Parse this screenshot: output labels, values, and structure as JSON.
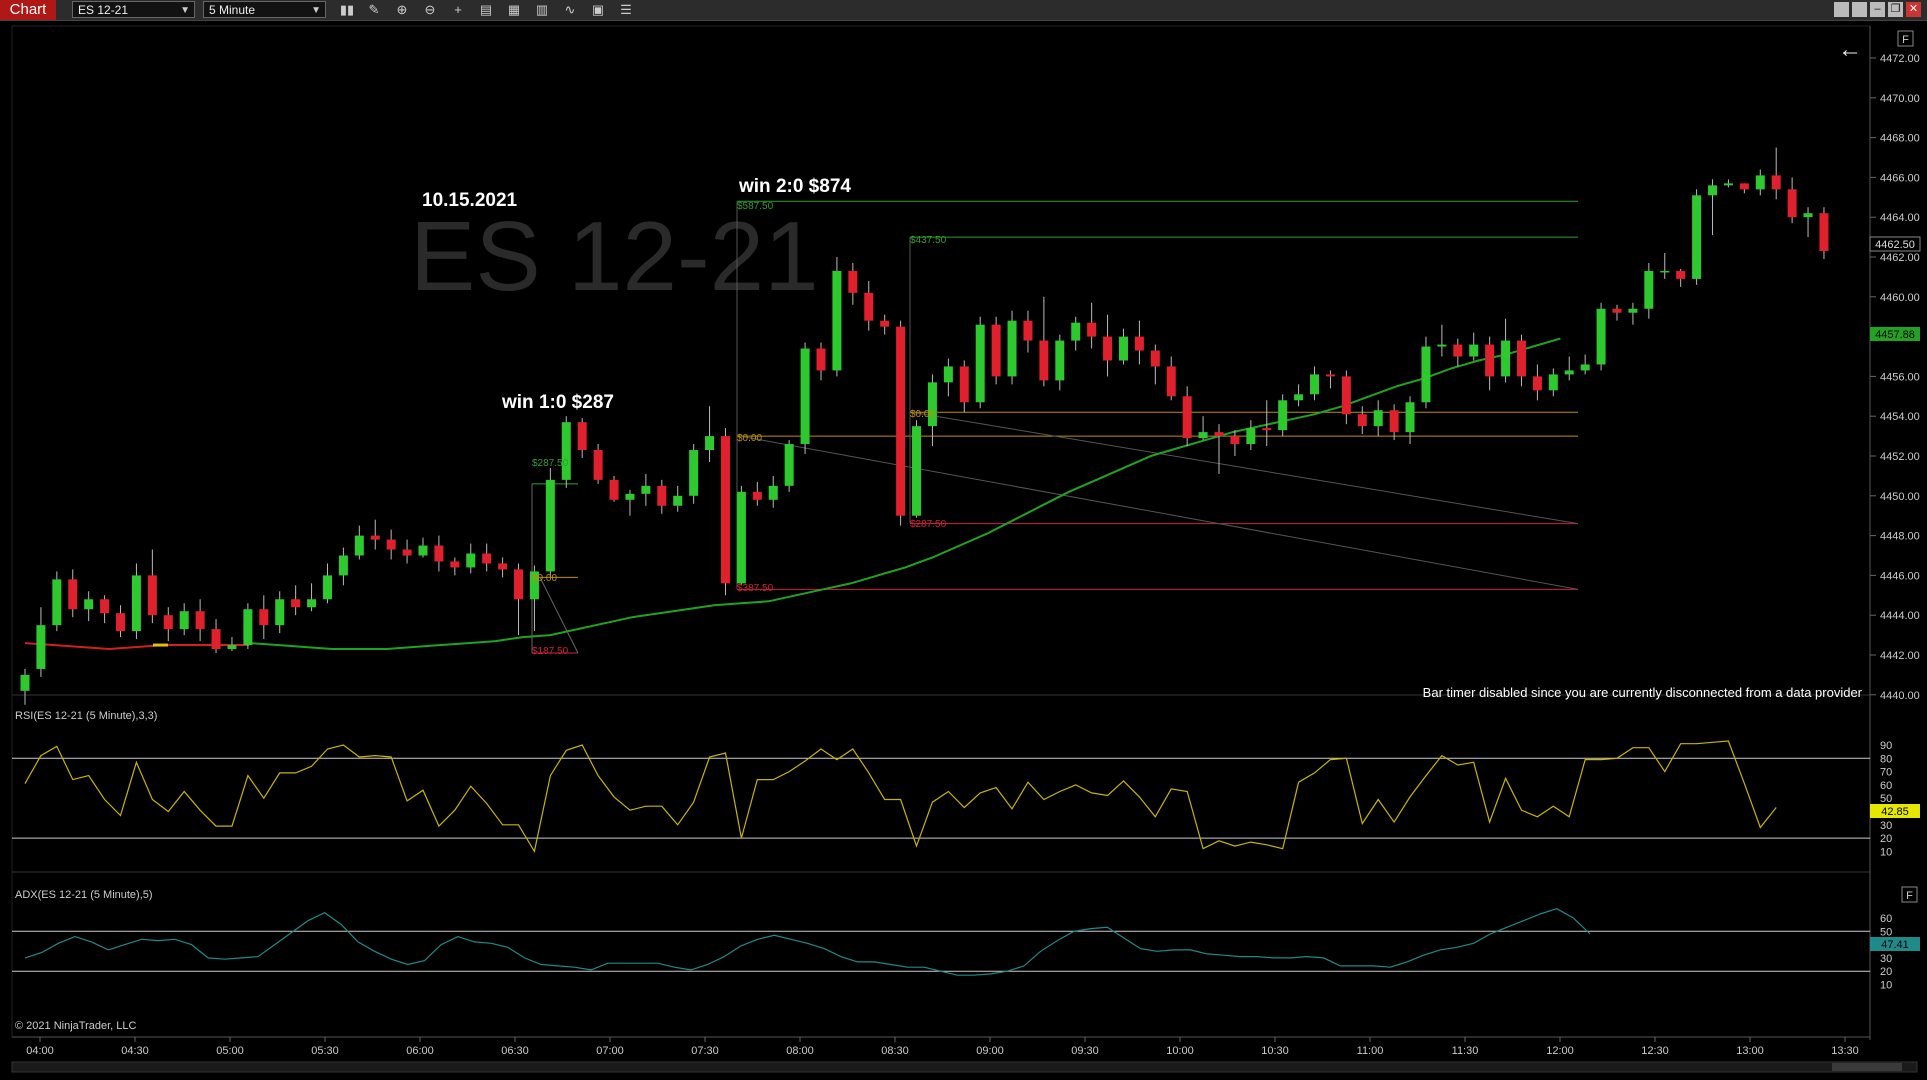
{
  "toolbar": {
    "tab_label": "Chart",
    "instrument": "ES 12-21",
    "interval": "5 Minute",
    "tools": [
      "bar-type-icon",
      "draw-pencil-icon",
      "zoom-in-icon",
      "zoom-out-icon",
      "crosshair-icon",
      "properties-icon",
      "data-box-icon",
      "indicators-icon",
      "strategies-icon",
      "templates-icon",
      "list-icon"
    ]
  },
  "chart": {
    "watermark": "ES 12-21",
    "date_label": "10.15.2021",
    "win1_label": "win 1:0 $287",
    "win2_label": "win 2:0 $874",
    "bar_timer_msg": "Bar timer disabled since you are currently disconnected from a data provider",
    "copyright": "© 2021 NinjaTrader, LLC",
    "f_button": "F",
    "current_price_label": "4462.50",
    "ma_value_label": "4457.88",
    "price_ticks": [
      "4472.00",
      "4470.00",
      "4468.00",
      "4466.00",
      "4464.00",
      "4462.00",
      "4460.00",
      "4458.00",
      "4456.00",
      "4454.00",
      "4452.00",
      "4450.00",
      "4448.00",
      "4446.00",
      "4444.00",
      "4442.00",
      "4440.00"
    ],
    "time_ticks": [
      "04:00",
      "04:30",
      "05:00",
      "05:30",
      "06:00",
      "06:30",
      "07:00",
      "07:30",
      "08:00",
      "08:30",
      "09:00",
      "09:30",
      "10:00",
      "10:30",
      "11:00",
      "11:30",
      "12:00",
      "12:30",
      "13:00",
      "13:30"
    ],
    "trade_labels": {
      "t1_profit": "$287.50",
      "t1_entry": "$0.00",
      "t1_stop": "$187.50",
      "t2_target1": "$587.50",
      "t2_target2": "$437.50",
      "t2_entry1": "$0.00",
      "t2_entry2": "$0.00",
      "t2_stop1": "$287.50",
      "t2_stop2": "$387.50"
    },
    "colors": {
      "up": "#2ec92e",
      "down": "#e0202c",
      "ma": "#21a321",
      "rsi": "#c8b400",
      "adx": "#1f8a8a",
      "target": "#2f9e2f",
      "entry": "#c09000",
      "stop": "#d0203a"
    }
  },
  "rsi": {
    "title": "RSI(ES 12-21 (5 Minute),3,3)",
    "value_label": "42.85",
    "ticks": [
      "90",
      "80",
      "70",
      "60",
      "50",
      "40",
      "30",
      "20",
      "10"
    ],
    "values": [
      61,
      82,
      89,
      64,
      67,
      49,
      37,
      77,
      49,
      40,
      55,
      41,
      29,
      29,
      67,
      50,
      69,
      69,
      74,
      87,
      90,
      81,
      82,
      81,
      48,
      56,
      29,
      41,
      59,
      46,
      30,
      30,
      10,
      67,
      86,
      90,
      67,
      51,
      41,
      44,
      44,
      30,
      47,
      81,
      84,
      20,
      64,
      64,
      70,
      78,
      87,
      79,
      87,
      69,
      49,
      49,
      14,
      47,
      55,
      43,
      54,
      58,
      42,
      62,
      49,
      55,
      60,
      54,
      52,
      63,
      51,
      36,
      57,
      55,
      12,
      18,
      14,
      17,
      15,
      12,
      62,
      69,
      79,
      80,
      31,
      49,
      32,
      51,
      67,
      82,
      75,
      77,
      32,
      65,
      41,
      36,
      44,
      36,
      79,
      79,
      80,
      88,
      88,
      70,
      91,
      91,
      92,
      93,
      61,
      28,
      43
    ]
  },
  "adx": {
    "title": "ADX(ES 12-21 (5 Minute),5)",
    "value_label": "47.41",
    "ticks": [
      "60",
      "50",
      "40",
      "30",
      "20",
      "10"
    ],
    "values": [
      30,
      34,
      41,
      46,
      42,
      36,
      40,
      44,
      43,
      44,
      40,
      30,
      29,
      30,
      31,
      40,
      49,
      58,
      64,
      55,
      42,
      35,
      29,
      25,
      28,
      40,
      46,
      42,
      41,
      38,
      30,
      25,
      24,
      23,
      21,
      26,
      26,
      26,
      26,
      23,
      21,
      25,
      31,
      39,
      44,
      47,
      44,
      41,
      37,
      31,
      27,
      27,
      25,
      23,
      23,
      20,
      17,
      17,
      18,
      20,
      24,
      35,
      43,
      50,
      52,
      53,
      45,
      37,
      35,
      36,
      36,
      33,
      32,
      31,
      31,
      30,
      30,
      31,
      30,
      24,
      24,
      24,
      23,
      27,
      32,
      36,
      38,
      41,
      48,
      53,
      58,
      63,
      67,
      60,
      48
    ]
  },
  "candles": [
    [
      4440.2,
      4441.0,
      4439.5,
      4441.3
    ],
    [
      4441.3,
      4443.5,
      4440.9,
      4444.4
    ],
    [
      4443.5,
      4445.8,
      4443.2,
      4446.2
    ],
    [
      4445.8,
      4444.3,
      4443.9,
      4446.3
    ],
    [
      4444.3,
      4444.8,
      4443.7,
      4445.2
    ],
    [
      4444.8,
      4444.1,
      4443.6,
      4445.0
    ],
    [
      4444.1,
      4443.2,
      4442.9,
      4444.5
    ],
    [
      4443.2,
      4446.0,
      4442.8,
      4446.6
    ],
    [
      4446.0,
      4444.0,
      4443.6,
      4447.3
    ],
    [
      4444.0,
      4443.3,
      4442.7,
      4444.4
    ],
    [
      4443.3,
      4444.2,
      4443.0,
      4444.6
    ],
    [
      4444.2,
      4443.3,
      4442.7,
      4444.8
    ],
    [
      4443.3,
      4442.3,
      4442.1,
      4443.8
    ],
    [
      4442.3,
      4442.5,
      4442.2,
      4442.9
    ],
    [
      4442.5,
      4444.3,
      4442.3,
      4444.6
    ],
    [
      4444.3,
      4443.5,
      4442.8,
      4445.0
    ],
    [
      4443.5,
      4444.8,
      4443.1,
      4445.2
    ],
    [
      4444.8,
      4444.4,
      4444.0,
      4445.5
    ],
    [
      4444.4,
      4444.8,
      4444.2,
      4445.6
    ],
    [
      4444.8,
      4446.0,
      4444.6,
      4446.6
    ],
    [
      4446.0,
      4447.0,
      4445.5,
      4447.4
    ],
    [
      4447.0,
      4448.0,
      4446.8,
      4448.5
    ],
    [
      4448.0,
      4447.8,
      4447.3,
      4448.8
    ],
    [
      4447.8,
      4447.3,
      4446.8,
      4448.3
    ],
    [
      4447.3,
      4447.0,
      4446.6,
      4447.8
    ],
    [
      4447.0,
      4447.5,
      4446.9,
      4447.9
    ],
    [
      4447.5,
      4446.7,
      4446.2,
      4448.0
    ],
    [
      4446.7,
      4446.4,
      4446.0,
      4446.9
    ],
    [
      4446.4,
      4447.1,
      4446.1,
      4447.6
    ],
    [
      4447.1,
      4446.6,
      4446.2,
      4447.6
    ],
    [
      4446.6,
      4446.3,
      4445.9,
      4446.9
    ],
    [
      4446.3,
      4444.8,
      4443.0,
      4446.6
    ],
    [
      4444.8,
      4446.2,
      4443.2,
      4446.5
    ],
    [
      4446.2,
      4450.8,
      4445.9,
      4451.4
    ],
    [
      4450.8,
      4453.7,
      4450.4,
      4454.0
    ],
    [
      4453.7,
      4452.3,
      4451.9,
      4453.9
    ],
    [
      4452.3,
      4450.8,
      4450.6,
      4452.6
    ],
    [
      4450.8,
      4449.8,
      4449.7,
      4451.0
    ],
    [
      4449.8,
      4450.1,
      4449.0,
      4450.3
    ],
    [
      4450.1,
      4450.5,
      4449.5,
      4451.1
    ],
    [
      4450.5,
      4449.5,
      4449.1,
      4450.8
    ],
    [
      4449.5,
      4450.0,
      4449.2,
      4450.5
    ],
    [
      4450.0,
      4452.3,
      4449.6,
      4452.6
    ],
    [
      4452.3,
      4453.0,
      4451.7,
      4454.5
    ],
    [
      4453.0,
      4445.6,
      4445.0,
      4453.4
    ],
    [
      4445.6,
      4450.2,
      4445.5,
      4450.5
    ],
    [
      4450.2,
      4449.8,
      4449.5,
      4450.7
    ],
    [
      4449.8,
      4450.5,
      4449.4,
      4451.0
    ],
    [
      4450.5,
      4452.6,
      4450.2,
      4452.8
    ],
    [
      4452.6,
      4457.4,
      4452.1,
      4457.7
    ],
    [
      4457.4,
      4456.3,
      4455.8,
      4457.7
    ],
    [
      4456.3,
      4461.3,
      4456.0,
      4462.0
    ],
    [
      4461.3,
      4460.2,
      4459.6,
      4461.7
    ],
    [
      4460.2,
      4458.8,
      4458.3,
      4460.8
    ],
    [
      4458.8,
      4458.5,
      4458.1,
      4459.1
    ],
    [
      4458.5,
      4449.0,
      4448.5,
      4458.8
    ],
    [
      4449.0,
      4453.5,
      4448.9,
      4453.8
    ],
    [
      4453.5,
      4455.7,
      4452.5,
      4456.1
    ],
    [
      4455.7,
      4456.5,
      4455.0,
      4456.9
    ],
    [
      4456.5,
      4454.7,
      4454.2,
      4456.8
    ],
    [
      4454.7,
      4458.6,
      4454.4,
      4459.0
    ],
    [
      4458.6,
      4456.0,
      4455.6,
      4459.0
    ],
    [
      4456.0,
      4458.8,
      4455.6,
      4459.3
    ],
    [
      4458.8,
      4457.8,
      4457.2,
      4459.3
    ],
    [
      4457.8,
      4455.8,
      4455.5,
      4460.0
    ],
    [
      4455.8,
      4457.8,
      4455.3,
      4458.1
    ],
    [
      4457.8,
      4458.7,
      4457.3,
      4459.0
    ],
    [
      4458.7,
      4458.0,
      4457.4,
      4459.7
    ],
    [
      4458.0,
      4456.8,
      4456.0,
      4459.1
    ],
    [
      4456.8,
      4458.0,
      4456.6,
      4458.4
    ],
    [
      4458.0,
      4457.3,
      4456.6,
      4458.8
    ],
    [
      4457.3,
      4456.5,
      4455.6,
      4457.6
    ],
    [
      4456.5,
      4455.0,
      4454.8,
      4457.0
    ],
    [
      4455.0,
      4452.9,
      4452.5,
      4455.5
    ],
    [
      4452.9,
      4453.2,
      4452.8,
      4454.0
    ],
    [
      4453.2,
      4453.0,
      4451.1,
      4453.6
    ],
    [
      4453.0,
      4452.6,
      4452.0,
      4453.3
    ],
    [
      4452.6,
      4453.4,
      4452.3,
      4453.8
    ],
    [
      4453.4,
      4453.3,
      4452.5,
      4454.8
    ],
    [
      4453.3,
      4454.8,
      4453.0,
      4455.1
    ],
    [
      4454.8,
      4455.1,
      4454.5,
      4455.6
    ],
    [
      4455.1,
      4456.1,
      4454.8,
      4456.5
    ],
    [
      4456.1,
      4456.0,
      4455.4,
      4456.3
    ],
    [
      4456.0,
      4454.1,
      4453.6,
      4456.3
    ],
    [
      4454.1,
      4453.5,
      4453.1,
      4454.5
    ],
    [
      4453.5,
      4454.3,
      4453.0,
      4454.8
    ],
    [
      4454.3,
      4453.2,
      4452.8,
      4454.6
    ],
    [
      4453.2,
      4454.7,
      4452.6,
      4455.0
    ],
    [
      4454.7,
      4457.5,
      4454.4,
      4458.0
    ],
    [
      4457.5,
      4457.6,
      4457.0,
      4458.6
    ],
    [
      4457.6,
      4457.0,
      4456.5,
      4457.9
    ],
    [
      4457.0,
      4457.6,
      4456.8,
      4458.2
    ],
    [
      4457.6,
      4456.0,
      4455.3,
      4458.0
    ],
    [
      4456.0,
      4457.8,
      4455.7,
      4458.9
    ],
    [
      4457.8,
      4456.0,
      4455.5,
      4458.1
    ],
    [
      4456.0,
      4455.3,
      4454.8,
      4456.6
    ],
    [
      4455.3,
      4456.1,
      4455.0,
      4456.4
    ],
    [
      4456.1,
      4456.3,
      4455.8,
      4457.0
    ],
    [
      4456.3,
      4456.6,
      4456.1,
      4457.1
    ],
    [
      4456.6,
      4459.4,
      4456.3,
      4459.7
    ],
    [
      4459.4,
      4459.2,
      4458.8,
      4459.6
    ],
    [
      4459.2,
      4459.4,
      4458.6,
      4459.7
    ],
    [
      4459.4,
      4461.3,
      4458.9,
      4461.7
    ],
    [
      4461.3,
      4461.3,
      4460.9,
      4462.2
    ],
    [
      4461.3,
      4460.9,
      4460.5,
      4461.4
    ],
    [
      4460.9,
      4465.1,
      4460.6,
      4465.4
    ],
    [
      4465.1,
      4465.6,
      4463.1,
      4465.9
    ],
    [
      4465.6,
      4465.7,
      4465.5,
      4465.9
    ],
    [
      4465.7,
      4465.4,
      4465.2,
      4465.7
    ],
    [
      4465.4,
      4466.1,
      4465.1,
      4466.4
    ],
    [
      4466.1,
      4465.4,
      4464.9,
      4467.5
    ],
    [
      4465.4,
      4464.0,
      4463.7,
      4466.0
    ],
    [
      4464.0,
      4464.2,
      4463.0,
      4464.5
    ],
    [
      4464.2,
      4462.3,
      4461.9,
      4464.5
    ]
  ],
  "ma": [
    4442.6,
    4442.5,
    4442.4,
    4442.3,
    4442.3,
    4442.3,
    4442.4,
    4442.5,
    4442.6,
    4442.7,
    4442.9,
    4443.0,
    4443.3,
    4443.6,
    4443.9,
    4444.1,
    4444.3,
    4444.5,
    4444.6,
    4444.7,
    4445.0,
    4445.3,
    4445.6,
    4446.0,
    4446.4,
    4446.9,
    4447.5,
    4448.1,
    4448.8,
    4449.5,
    4450.2,
    4450.8,
    4451.4,
    4452.0,
    4452.4,
    4452.8,
    4453.2,
    4453.5,
    4453.8,
    4454.1,
    4454.5,
    4455.0,
    4455.5,
    4455.9,
    4456.4,
    4456.8,
    4457.1,
    4457.5,
    4457.9
  ],
  "ma_colored_seg": [
    4442.6,
    4442.5,
    4442.4,
    4442.3,
    4442.4,
    4442.5,
    4442.5,
    4442.5,
    4442.5
  ]
}
